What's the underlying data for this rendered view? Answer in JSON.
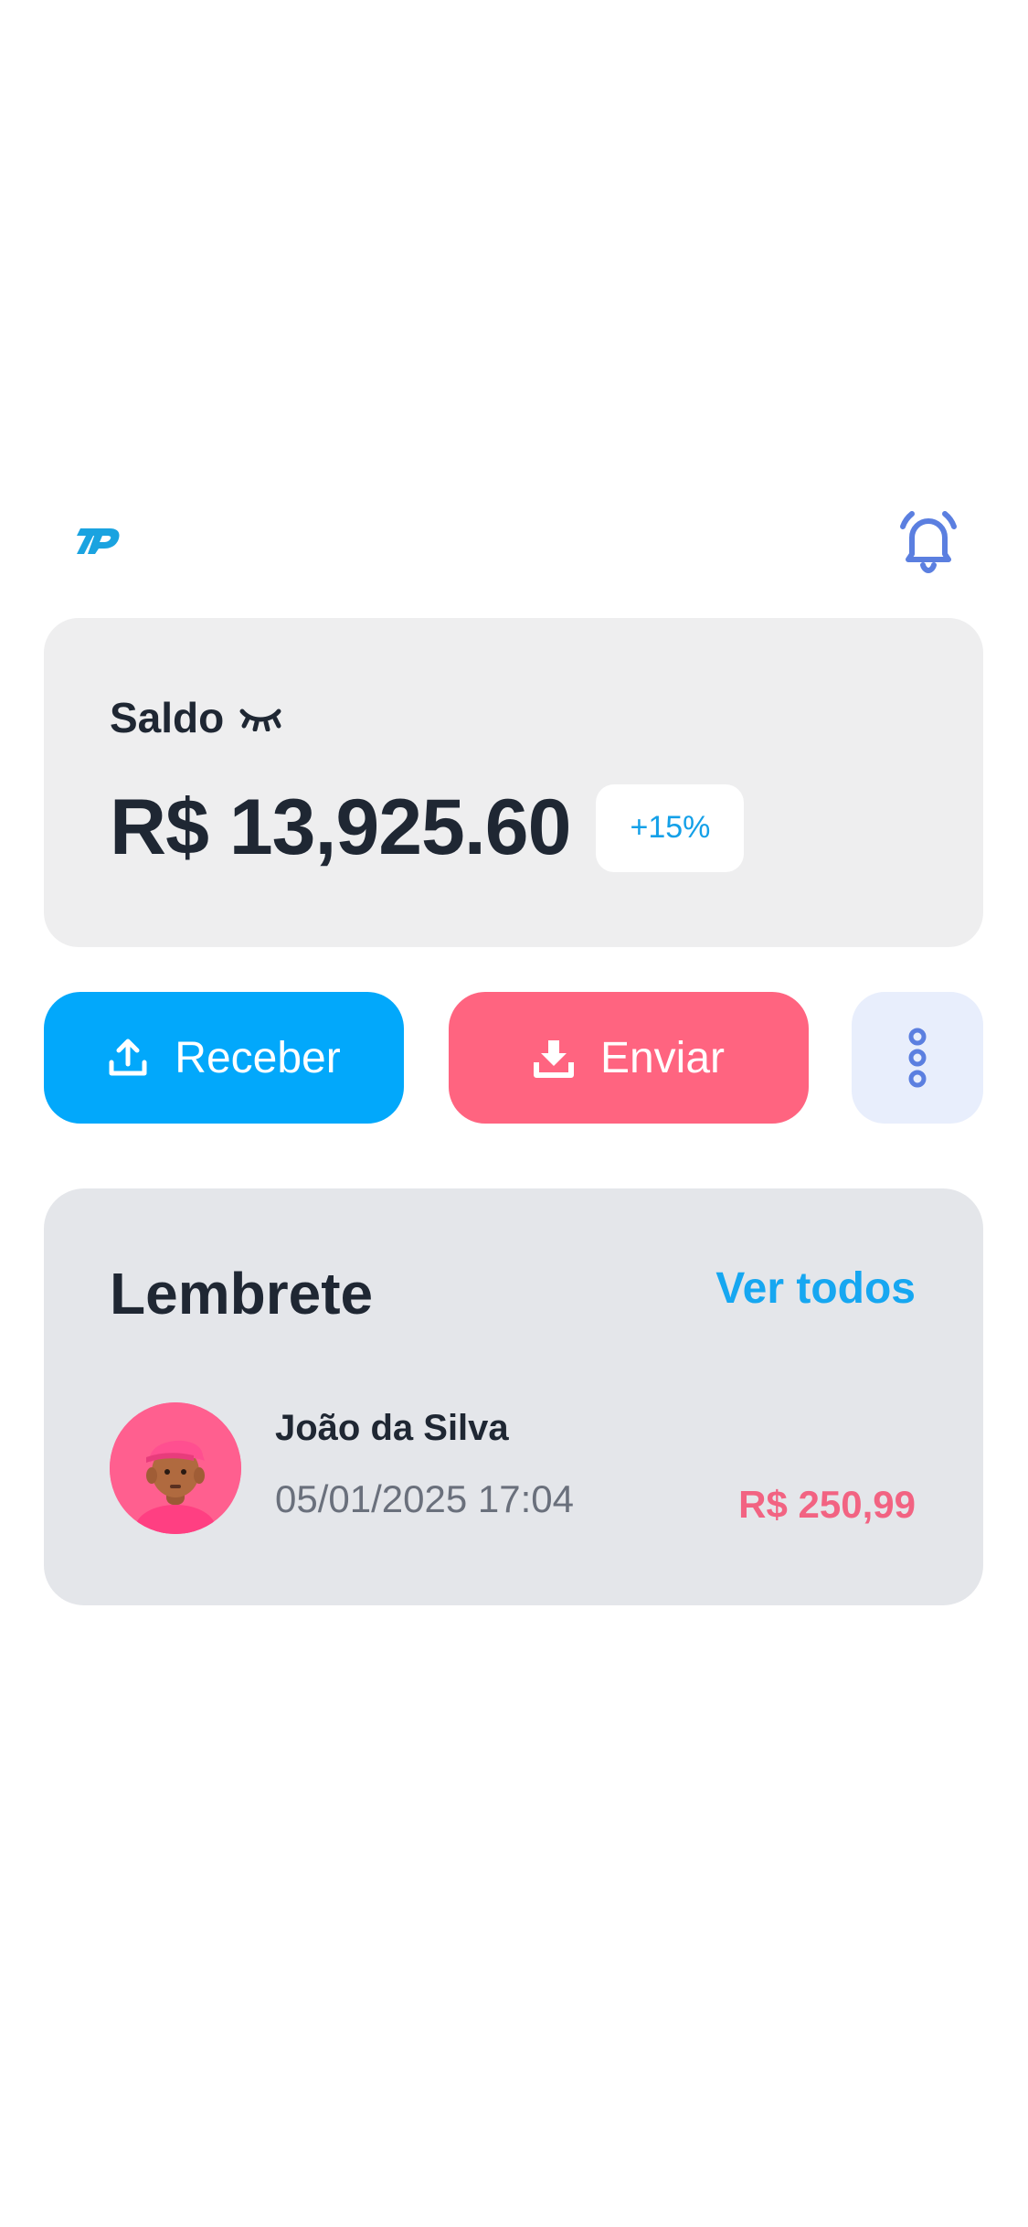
{
  "header": {
    "logo": "zp-logo-icon",
    "notification": "bell-icon"
  },
  "balance": {
    "label": "Saldo",
    "visibility_icon": "eye-closed-icon",
    "value": "R$ 13,925.60",
    "change": "+15%"
  },
  "actions": {
    "receive_label": "Receber",
    "receive_icon": "upload-icon",
    "send_label": "Enviar",
    "send_icon": "download-icon",
    "more_icon": "more-vertical-icon"
  },
  "reminders": {
    "title": "Lembrete",
    "see_all": "Ver todos",
    "items": [
      {
        "name": "João da Silva",
        "datetime": "05/01/2025 17:04",
        "amount": "R$ 250,99",
        "avatar": "avatar-image"
      }
    ]
  },
  "colors": {
    "primary": "#02a8fb",
    "danger": "#ff6480",
    "icon_blue": "#5b7fe0",
    "text_dark": "#1f2733"
  }
}
